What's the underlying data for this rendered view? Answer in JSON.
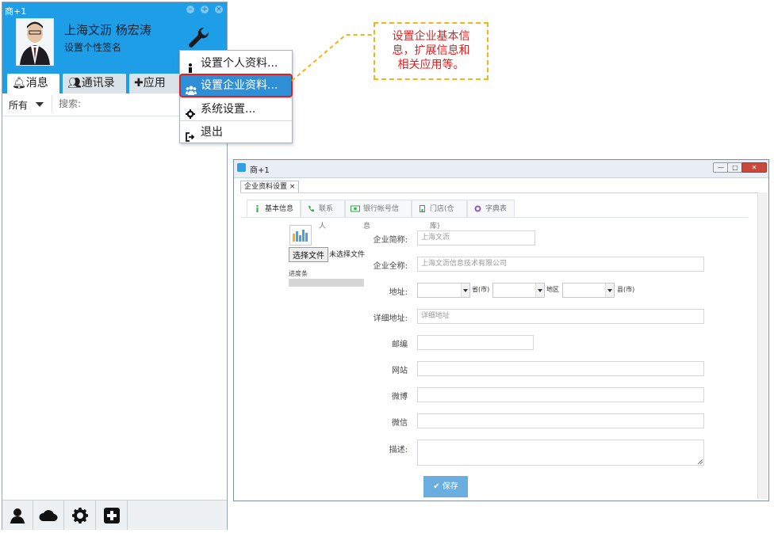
{
  "client": {
    "title": "商+1",
    "user_name": "上海文沥 杨宏涛",
    "signature": "设置个性签名",
    "tabs": [
      {
        "label": "消息",
        "icon": "bell-icon"
      },
      {
        "label": "通讯录",
        "icon": "users-icon"
      },
      {
        "label": "应用",
        "icon": "puzzle-icon"
      }
    ],
    "filter_label": "所有",
    "search_placeholder": "搜索:",
    "toolbar": [
      {
        "icon": "user-icon"
      },
      {
        "icon": "cloud-icon"
      },
      {
        "icon": "gear-icon"
      },
      {
        "icon": "plus-square-icon"
      }
    ]
  },
  "menu": {
    "items": [
      {
        "label": "设置个人资料...",
        "icon": "person-icon"
      },
      {
        "label": "设置企业资料...",
        "icon": "group-icon",
        "highlighted": true
      },
      {
        "label": "系统设置...",
        "icon": "gear-icon"
      },
      {
        "label": "退出",
        "icon": "sign-out-icon"
      }
    ]
  },
  "callout": {
    "text_lines": [
      "设置企业基本信",
      "息，扩展信息和",
      "相关应用等。"
    ]
  },
  "window": {
    "title": "商+1",
    "doc_tab": "企业资料设置 ×",
    "subtabs": [
      {
        "label": "基本信息",
        "icon": "info-icon"
      },
      {
        "label": "联系人",
        "icon": "phone-icon"
      },
      {
        "label": "银行帐号信息",
        "icon": "money-icon"
      },
      {
        "label": "门店(仓库)",
        "icon": "store-icon"
      },
      {
        "label": "字典表",
        "icon": "cog-icon"
      }
    ],
    "upload": {
      "button": "选择文件",
      "no_file": "未选择文件",
      "progress_label": "进度条"
    },
    "fields": {
      "short_name_label": "企业简称:",
      "short_name_value": "上海文沥",
      "full_name_label": "企业全称:",
      "full_name_value": "上海文沥信息技术有限公司",
      "address_label": "地址:",
      "province_suffix": "省(市)",
      "district_label": "地区",
      "county_suffix": "县(市)",
      "detail_address_label": "详细地址:",
      "detail_address_placeholder": "详细地址",
      "postcode_label": "邮编",
      "website_label": "网站",
      "weibo_label": "微博",
      "wechat_label": "微信",
      "description_label": "描述:"
    },
    "save_button": "✔ 保存"
  },
  "colors": {
    "header_blue": "#1e9ee6",
    "highlight_blue": "#2f8fd6",
    "callout_border": "#f2b418",
    "callout_text": "#e02020",
    "save_button": "#6aaee0"
  }
}
